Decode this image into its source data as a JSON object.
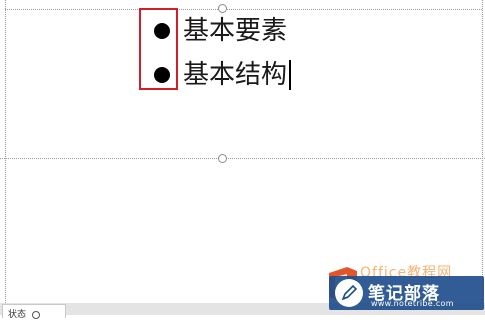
{
  "slide": {
    "bullets": [
      {
        "text": "基本要素"
      },
      {
        "text": "基本结构"
      }
    ]
  },
  "status_bar": {
    "tab_label": "状态"
  },
  "watermark": {
    "top_text": "Office教程网",
    "site_name": "笔记部落",
    "site_url": "www.notetribe.com",
    "badge_color": "#1f4e8c",
    "accent_color": "#e2562a"
  },
  "colors": {
    "highlight_border": "#d21e28",
    "placeholder_border": "#9a9a9a"
  }
}
